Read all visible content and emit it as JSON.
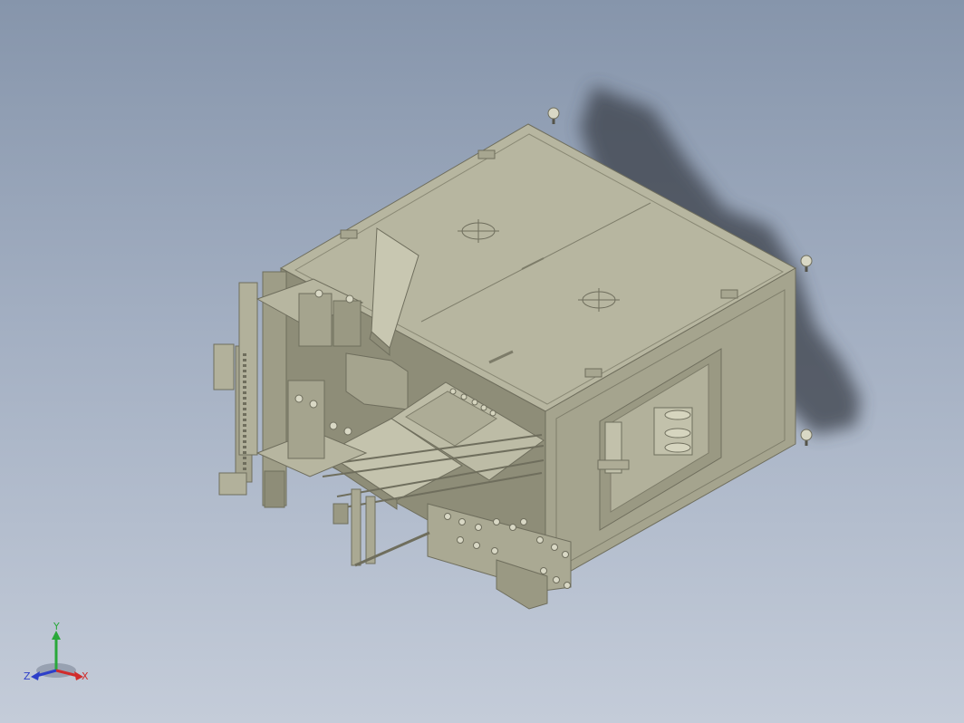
{
  "viewport": {
    "background_top": "#8695ab",
    "background_bottom": "#c4ccd9",
    "model_color": "#b4b39c",
    "model_shade": "#9a9983",
    "model_dark": "#7d7c69",
    "shadow_color": "#3a3f4a"
  },
  "triad": {
    "x_label": "X",
    "y_label": "Y",
    "z_label": "Z",
    "x_color": "#d12c2c",
    "y_color": "#29a83a",
    "z_color": "#2d3fc9"
  }
}
